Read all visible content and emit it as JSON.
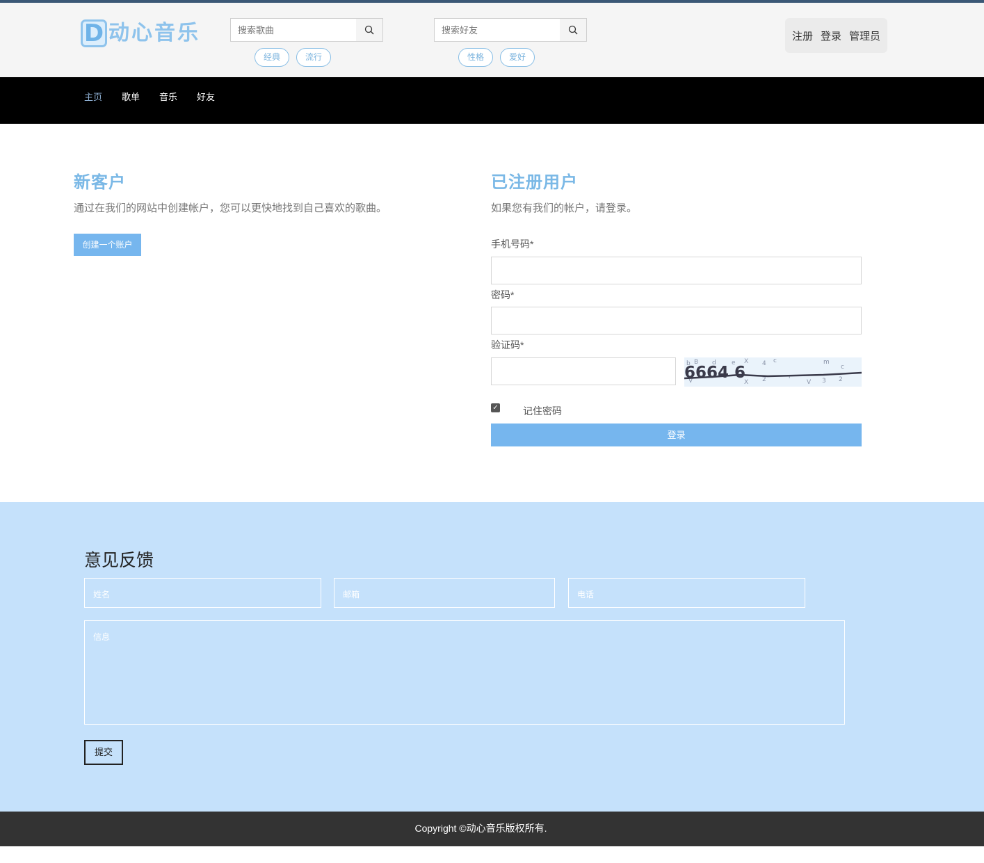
{
  "header": {
    "logo_letter": "D",
    "logo_text": "动心音乐",
    "song_search": {
      "placeholder": "搜索歌曲",
      "tags": [
        "经典",
        "流行"
      ]
    },
    "friend_search": {
      "placeholder": "搜索好友",
      "tags": [
        "性格",
        "爱好"
      ]
    },
    "user_links": {
      "register": "注册",
      "login": "登录",
      "admin": "管理员"
    }
  },
  "nav": {
    "items": [
      "主页",
      "歌单",
      "音乐",
      "好友"
    ],
    "active_index": 0
  },
  "new_customer": {
    "title": "新客户",
    "description": "通过在我们的网站中创建帐户，您可以更快地找到自己喜欢的歌曲。",
    "create_button": "创建一个账户"
  },
  "registered": {
    "title": "已注册用户",
    "description": "如果您有我们的帐户，请登录。",
    "phone_label": "手机号码*",
    "password_label": "密码*",
    "captcha_label": "验证码*",
    "captcha_text": "6664 6",
    "remember_label": "记住密码",
    "remember_checked": true,
    "login_button": "登录"
  },
  "feedback": {
    "title": "意见反馈",
    "name_placeholder": "姓名",
    "email_placeholder": "邮箱",
    "phone_placeholder": "电话",
    "message_placeholder": "信息",
    "submit_label": "提交"
  },
  "footer": {
    "copyright": "Copyright ©动心音乐版权所有."
  },
  "colors": {
    "accent": "#76b6ee",
    "title_blue": "#7ab8e6",
    "navbar": "#000000",
    "feedback_bg": "#c5e1fb",
    "footer_bg": "#333333"
  }
}
